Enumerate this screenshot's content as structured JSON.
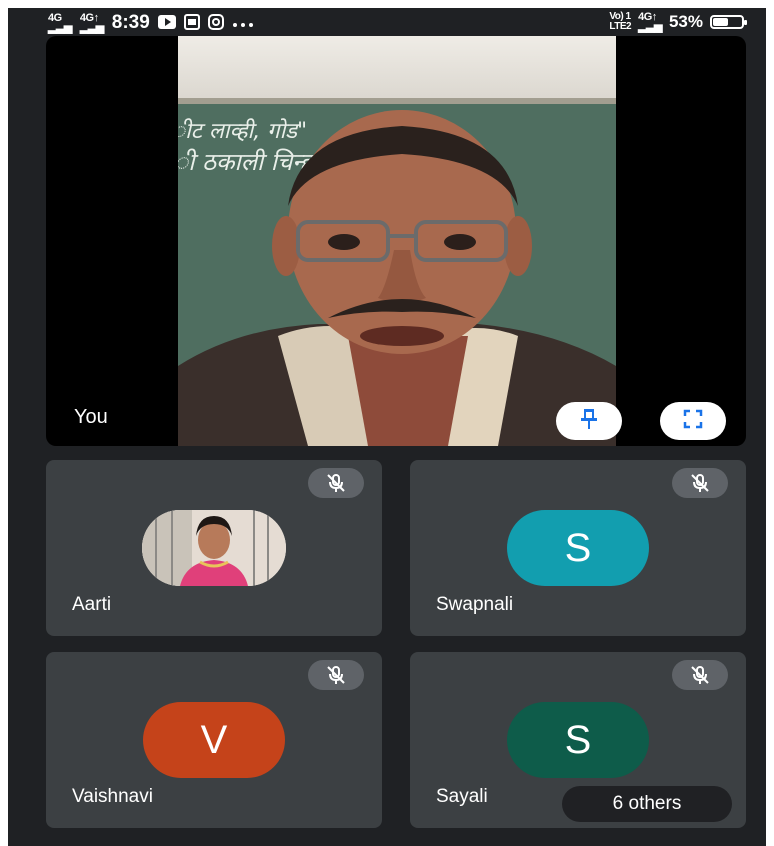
{
  "status_bar": {
    "signal_1": "4G",
    "signal_2": "4G↑",
    "time": "8:39",
    "icons": [
      "youtube-icon",
      "sim-icon",
      "instagram-icon",
      "more-dots-icon"
    ],
    "right_label_1": "Vo) 1\nLTE2",
    "right_label_2": "4G↑",
    "battery_percent": "53%",
    "battery_level": 0.53
  },
  "main_tile": {
    "label": "You",
    "board_text_1": "ीट लाव्ही, गोड\"",
    "board_text_2": "ी ठकाली चिन्ह. वि"
  },
  "participants": [
    {
      "name": "Aarti",
      "type": "photo",
      "muted": true
    },
    {
      "name": "Swapnali",
      "initial": "S",
      "color": "#129eaf",
      "muted": true
    },
    {
      "name": "Vaishnavi",
      "initial": "V",
      "color": "#c5431a",
      "muted": true
    },
    {
      "name": "Sayali",
      "initial": "S",
      "color": "#0e5c4a",
      "muted": true
    }
  ],
  "others_label": "6 others",
  "colors": {
    "background": "#1f2124",
    "tile": "#3c4043",
    "mute_pill": "#5f6368",
    "accent_blue": "#1a73e8"
  }
}
